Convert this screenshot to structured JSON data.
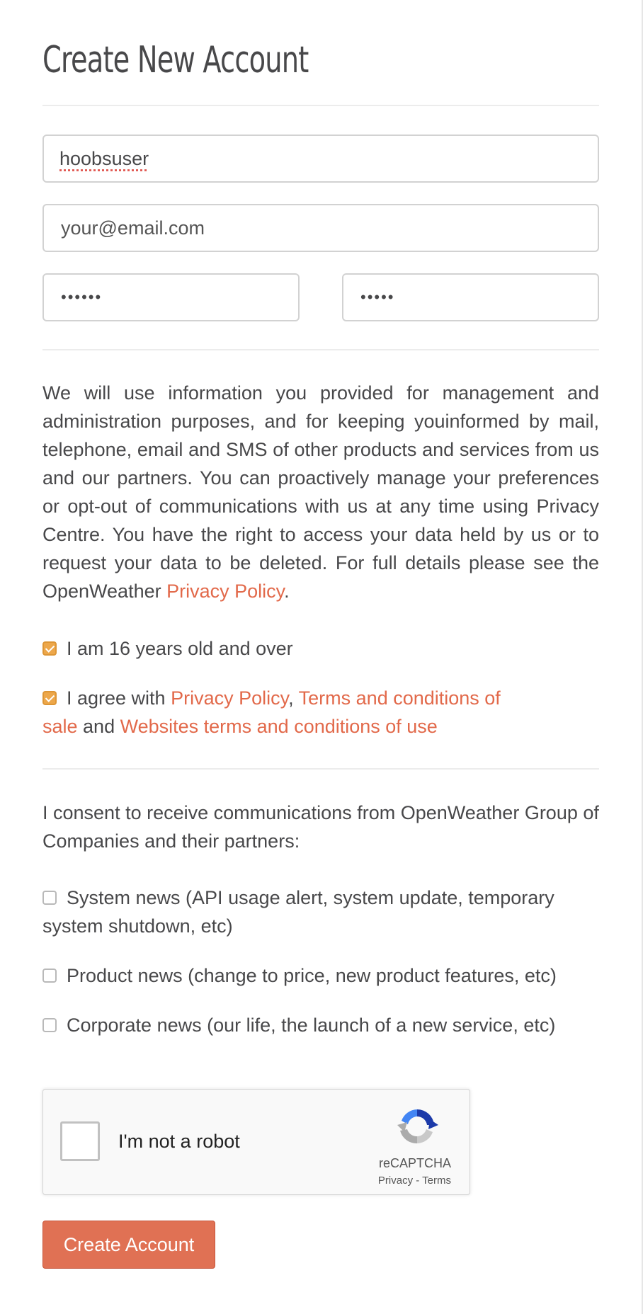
{
  "page": {
    "title": "Create New Account"
  },
  "form": {
    "username_value": "hoobsuser",
    "email_placeholder": "your@email.com",
    "password_value": "••••••",
    "password_confirm_value": "•••••"
  },
  "privacy": {
    "text": "We will use information you provided for management and administration purposes, and for keeping youinformed by mail, telephone, email and SMS of other products and services from us and our partners. You can proactively manage your preferences or opt-out of communications with us at any time using Privacy Centre. You have the right to access your data held by us or to request your data to be deleted. For full details please see the OpenWeather ",
    "link": "Privacy Policy",
    "end": "."
  },
  "agreements": {
    "age_label": "I am 16 years old and over",
    "age_checked": true,
    "agree_prefix": "I agree with ",
    "privacy_link": "Privacy Policy",
    "comma": ",",
    "terms_sale_link": "Terms and conditions of sale",
    "and": " and ",
    "terms_use_link": "Websites terms and conditions of use",
    "agree_checked": true
  },
  "consent": {
    "intro": "I consent to receive communications from OpenWeather Group of Companies and their partners:",
    "options": [
      {
        "label": "System news (API usage alert, system update, temporary system shutdown, etc)",
        "checked": false
      },
      {
        "label": "Product news (change to price, new product features, etc)",
        "checked": false
      },
      {
        "label": "Corporate news (our life, the launch of a new service, etc)",
        "checked": false
      }
    ]
  },
  "recaptcha": {
    "label": "I'm not a robot",
    "brand": "reCAPTCHA",
    "privacy": "Privacy",
    "separator": " - ",
    "terms": "Terms"
  },
  "submit": {
    "label": "Create Account"
  },
  "colors": {
    "accent": "#e2694a",
    "button": "#e07154",
    "checkbox_checked": "#eda74a",
    "text": "#48484a"
  }
}
